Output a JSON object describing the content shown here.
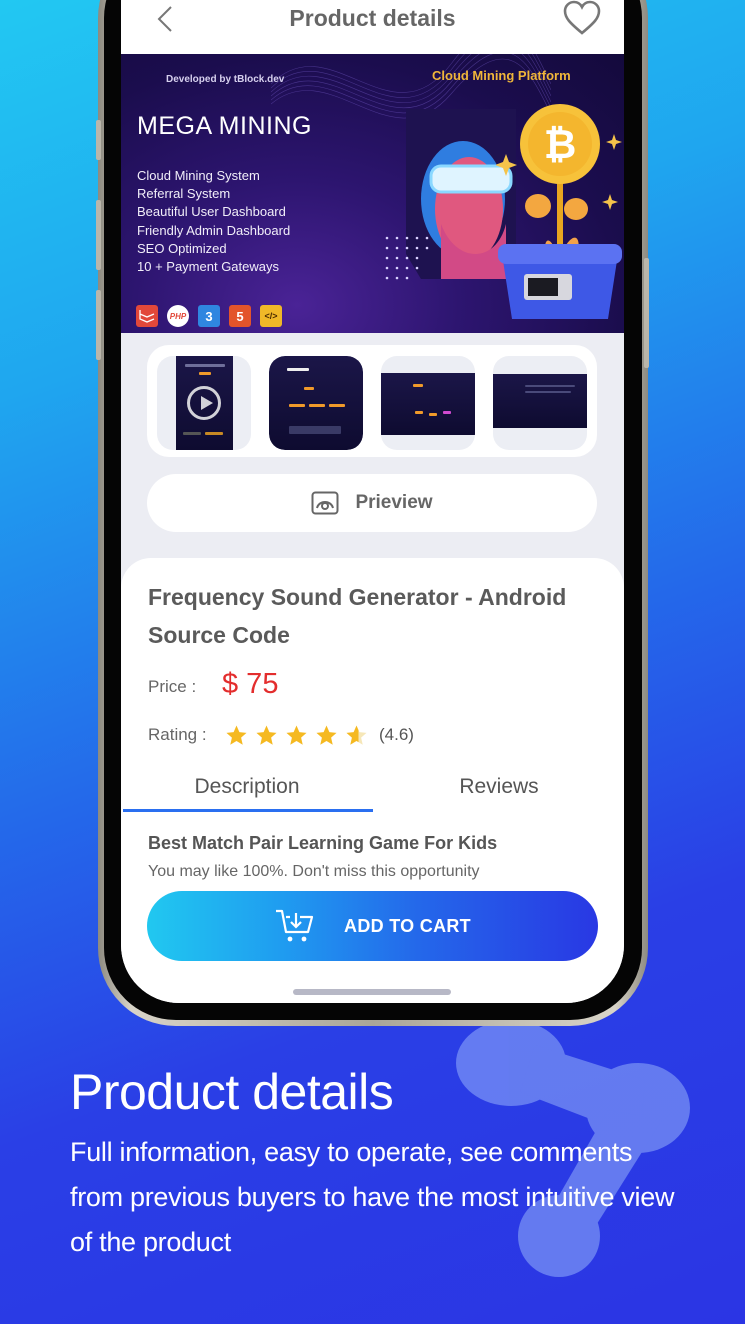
{
  "colors": {
    "bg_gradient_start": "#22c8f2",
    "bg_gradient_end": "#2b35e4",
    "price": "#e32d2d",
    "tab_indicator": "#2a6ff0",
    "star": "#f5b921",
    "banner_accent": "#f0b63a"
  },
  "header": {
    "back_icon": "chevron-left-icon",
    "title": "Product details",
    "favorite_icon": "heart-outline-icon"
  },
  "banner": {
    "developed_by": "Developed by tBlock.dev",
    "platform": "Cloud Mining Platform",
    "brand": "MEGA MINING",
    "features": [
      "Cloud Mining System",
      "Referral System",
      "Beautiful User Dashboard",
      "Friendly Admin Dashboard",
      "SEO Optimized",
      "10 + Payment Gateways"
    ],
    "tech_icons": [
      "laravel-icon",
      "php-icon",
      "css3-icon",
      "html5-icon",
      "code-icon"
    ],
    "php_label": "PHP",
    "code_label": "</>"
  },
  "thumbnails": [
    {
      "name": "video-preview",
      "has_play": true
    },
    {
      "name": "pricing-page"
    },
    {
      "name": "dashboard-plans"
    },
    {
      "name": "dashboard-table"
    }
  ],
  "preview": {
    "icon": "preview-eye-icon",
    "label": "Prieview"
  },
  "product": {
    "title": "Frequency Sound Generator - Android Source Code",
    "price_label": "Price :",
    "price": "$ 75",
    "rating_label": "Rating :",
    "rating": 4.6,
    "rating_text": "(4.6)",
    "stars_max": 5
  },
  "tabs": [
    {
      "label": "Description",
      "active": true
    },
    {
      "label": "Reviews",
      "active": false
    }
  ],
  "description": {
    "title": "Best Match Pair Learning Game For Kids",
    "text": "You may like 100%. Don't miss this opportunity"
  },
  "cart": {
    "icon": "cart-download-icon",
    "label": "ADD TO CART"
  },
  "caption": {
    "title": "Product details",
    "text": "Full information, easy to operate, see comments from previous buyers to have the most intuitive view of the product"
  }
}
